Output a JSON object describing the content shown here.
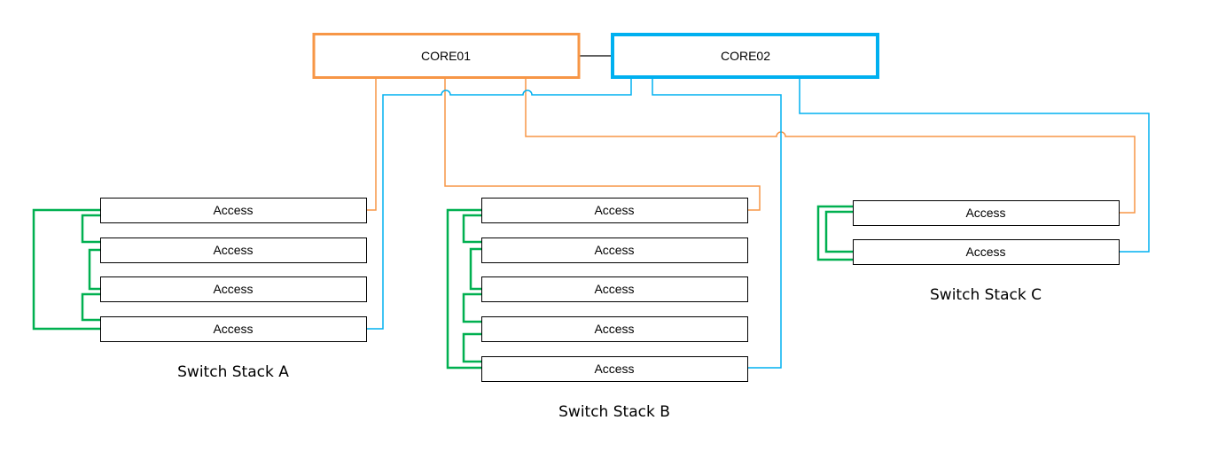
{
  "colors": {
    "core01": "#f79646",
    "core02": "#00b0f0",
    "stack_link": "#00b050",
    "core_interlink": "#000000",
    "box_border": "#000000"
  },
  "cores": [
    {
      "id": "core01",
      "label": "CORE01"
    },
    {
      "id": "core02",
      "label": "CORE02"
    }
  ],
  "stacks": [
    {
      "id": "a",
      "label": "Switch Stack A",
      "members": [
        "Access",
        "Access",
        "Access",
        "Access"
      ]
    },
    {
      "id": "b",
      "label": "Switch Stack B",
      "members": [
        "Access",
        "Access",
        "Access",
        "Access",
        "Access"
      ]
    },
    {
      "id": "c",
      "label": "Switch Stack C",
      "members": [
        "Access",
        "Access"
      ]
    }
  ],
  "links": [
    {
      "from": "core01",
      "to": "core02",
      "type": "interlink"
    },
    {
      "from": "core01",
      "to": "stack-a-member-1",
      "type": "uplink"
    },
    {
      "from": "core02",
      "to": "stack-a-member-4",
      "type": "uplink"
    },
    {
      "from": "core01",
      "to": "stack-b-member-1",
      "type": "uplink"
    },
    {
      "from": "core02",
      "to": "stack-b-member-5",
      "type": "uplink"
    },
    {
      "from": "core01",
      "to": "stack-c-member-1",
      "type": "uplink"
    },
    {
      "from": "core02",
      "to": "stack-c-member-2",
      "type": "uplink"
    }
  ]
}
